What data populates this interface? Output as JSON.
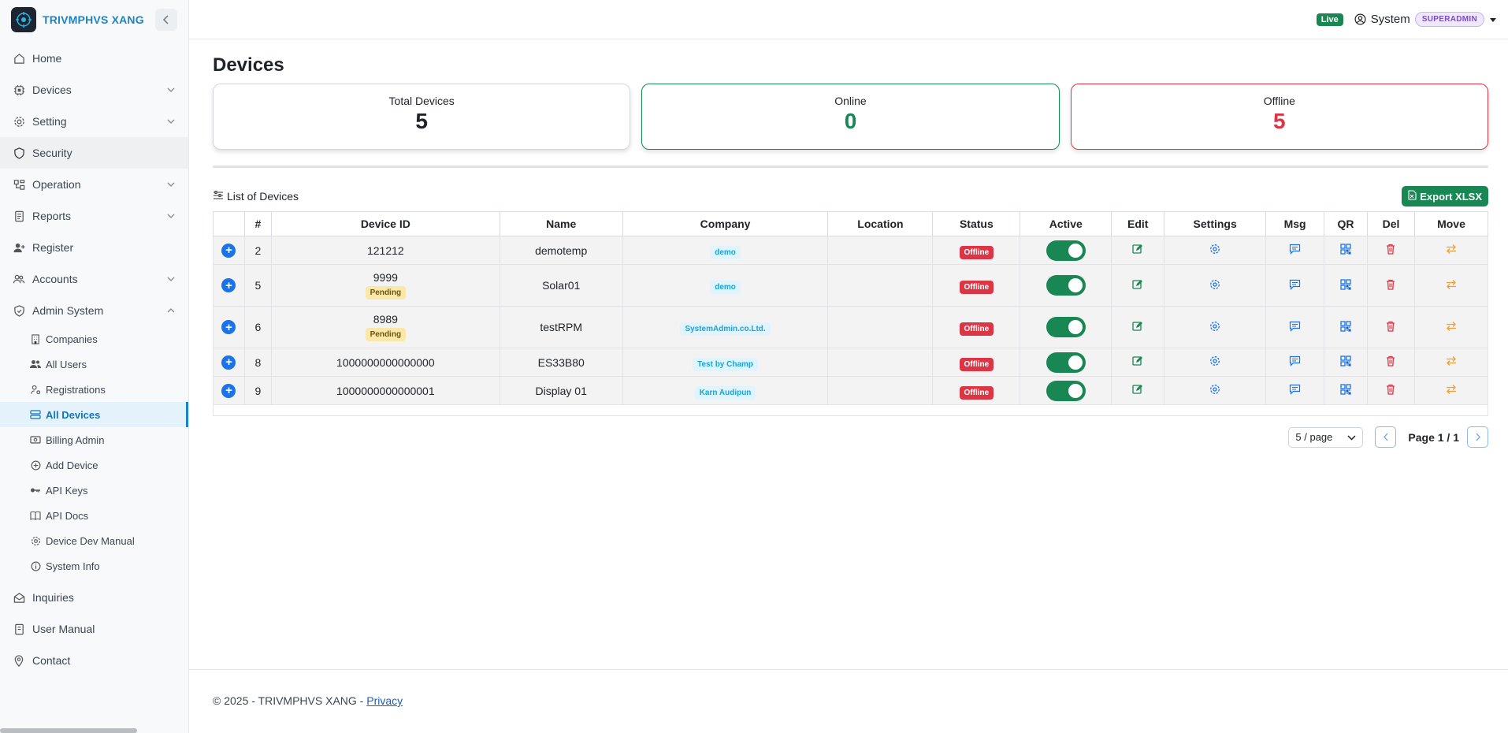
{
  "brand": {
    "name": "TRIVMPHVS XANG"
  },
  "sidebar": {
    "items": [
      {
        "label": "Home"
      },
      {
        "label": "Devices"
      },
      {
        "label": "Setting"
      },
      {
        "label": "Security"
      },
      {
        "label": "Operation"
      },
      {
        "label": "Reports"
      },
      {
        "label": "Register"
      },
      {
        "label": "Accounts"
      },
      {
        "label": "Admin System"
      }
    ],
    "admin_sub": [
      {
        "label": "Companies"
      },
      {
        "label": "All Users"
      },
      {
        "label": "Registrations"
      },
      {
        "label": "All Devices"
      },
      {
        "label": "Billing Admin"
      },
      {
        "label": "Add Device"
      },
      {
        "label": "API Keys"
      },
      {
        "label": "API Docs"
      },
      {
        "label": "Device Dev Manual"
      },
      {
        "label": "System Info"
      }
    ],
    "bottom": [
      {
        "label": "Inquiries"
      },
      {
        "label": "User Manual"
      },
      {
        "label": "Contact"
      }
    ]
  },
  "topbar": {
    "live": "Live",
    "user": "System",
    "role": "SUPERADMIN"
  },
  "page": {
    "title": "Devices"
  },
  "stats": {
    "total": {
      "label": "Total Devices",
      "value": "5"
    },
    "online": {
      "label": "Online",
      "value": "0"
    },
    "offline": {
      "label": "Offline",
      "value": "5"
    }
  },
  "list": {
    "title": "List of Devices",
    "export_label": "Export XLSX"
  },
  "table": {
    "headers": [
      "#",
      "Device ID",
      "Name",
      "Company",
      "Location",
      "Status",
      "Active",
      "Edit",
      "Settings",
      "Msg",
      "QR",
      "Del",
      "Move"
    ],
    "rows": [
      {
        "num": "2",
        "device_id": "121212",
        "pending": "",
        "name": "demotemp",
        "company": "demo",
        "location": "",
        "status": "Offline",
        "active": true
      },
      {
        "num": "5",
        "device_id": "9999",
        "pending": "Pending",
        "name": "Solar01",
        "company": "demo",
        "location": "",
        "status": "Offline",
        "active": true
      },
      {
        "num": "6",
        "device_id": "8989",
        "pending": "Pending",
        "name": "testRPM",
        "company": "SystemAdmin.co.Ltd.",
        "location": "",
        "status": "Offline",
        "active": true
      },
      {
        "num": "8",
        "device_id": "1000000000000000",
        "pending": "",
        "name": "ES33B80",
        "company": "Test by Champ",
        "location": "",
        "status": "Offline",
        "active": true
      },
      {
        "num": "9",
        "device_id": "1000000000000001",
        "pending": "",
        "name": "Display 01",
        "company": "Karn Audipun",
        "location": "",
        "status": "Offline",
        "active": true
      }
    ]
  },
  "pager": {
    "per_page": "5 / page",
    "page_label": "Page 1 / 1"
  },
  "footer": {
    "text": "© 2025 - TRIVMPHVS XANG - ",
    "privacy": "Privacy"
  },
  "colors": {
    "accent": "#1b84c4",
    "success": "#198754",
    "danger": "#dc3545",
    "warning": "#fbe7a8"
  }
}
